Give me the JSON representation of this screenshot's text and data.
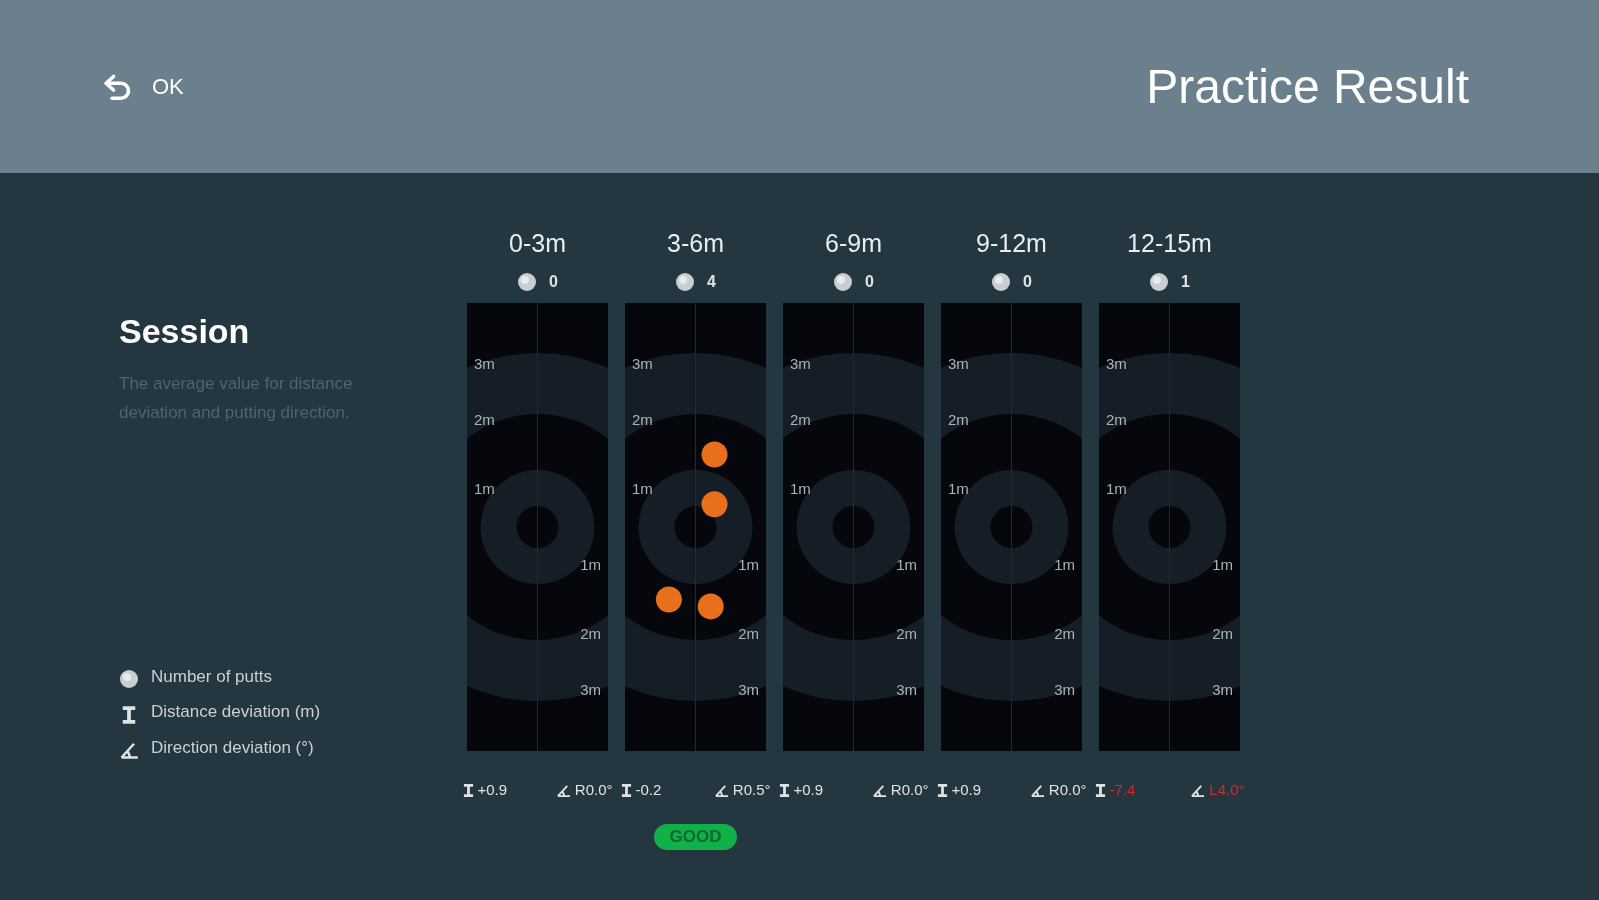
{
  "header": {
    "back_label": "OK",
    "title": "Practice Result"
  },
  "session": {
    "title": "Session",
    "description": "The average value for distance deviation and putting direction."
  },
  "legend": [
    {
      "kind": "putts",
      "label": "Number of putts"
    },
    {
      "kind": "distance",
      "label": "Distance deviation (m)"
    },
    {
      "kind": "direction",
      "label": "Direction deviation (°)"
    }
  ],
  "columns": [
    {
      "range": "0-3m",
      "putts": "0",
      "scale_labels": [
        "3m",
        "2m",
        "1m",
        "1m",
        "2m",
        "3m"
      ],
      "distance": "+0.9",
      "direction": "R0.0°",
      "alert": false
    },
    {
      "range": "3-6m",
      "putts": "4",
      "scale_labels": [
        "3m",
        "2m",
        "1m",
        "1m",
        "2m",
        "3m"
      ],
      "target": {
        "kind": "hits"
      },
      "distance": "-0.2",
      "direction": "R0.5°",
      "alert": false,
      "badge": "GOOD"
    },
    {
      "range": "6-9m",
      "putts": "0",
      "scale_labels": [
        "3m",
        "2m",
        "1m",
        "1m",
        "2m",
        "3m"
      ],
      "distance": "+0.9",
      "direction": "R0.0°",
      "alert": false
    },
    {
      "range": "9-12m",
      "putts": "0",
      "scale_labels": [
        "3m",
        "2m",
        "1m",
        "1m",
        "2m",
        "3m"
      ],
      "distance": "+0.9",
      "direction": "R0.0°",
      "alert": false
    },
    {
      "range": "12-15m",
      "putts": "1",
      "scale_labels": [
        "3m",
        "2m",
        "1m",
        "1m",
        "2m",
        "3m"
      ],
      "distance": "-7.4",
      "direction": "L4.0°",
      "alert": true
    }
  ]
}
